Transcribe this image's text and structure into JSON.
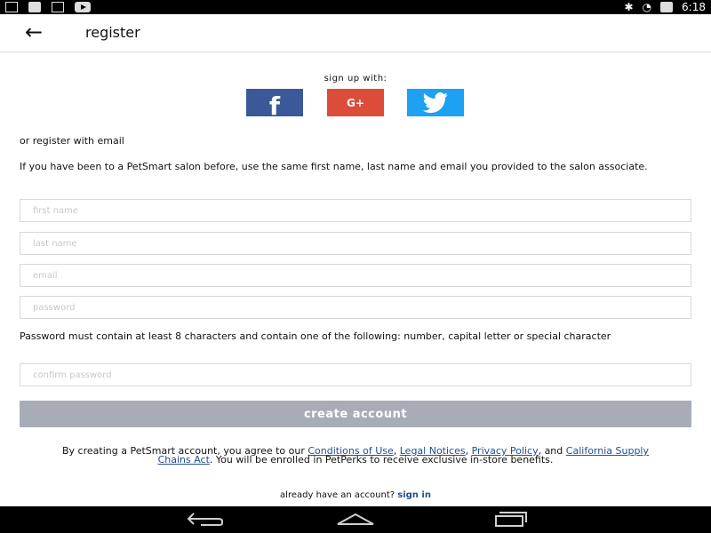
{
  "status_bar": {
    "time": "6:18",
    "left_icons": [
      "download-icon",
      "signal-bars-icon",
      "send-icon",
      "youtube-icon"
    ],
    "right_icons": [
      "bluetooth-icon",
      "wifi-icon",
      "battery-icon"
    ]
  },
  "toolbar": {
    "back_icon": "arrow-left-icon",
    "title": "register"
  },
  "social": {
    "heading": "sign up with:",
    "facebook_label": "f",
    "google_label": "G+",
    "twitter_icon": "twitter-bird-icon",
    "colors": {
      "facebook": "#3b5998",
      "google": "#dd4b39",
      "twitter": "#1da1f2"
    }
  },
  "form": {
    "or_text": "or register with email",
    "info_text": "If you have been to a PetSmart salon before, use the same first name, last name and email you provided to the salon associate.",
    "first_name_placeholder": "first name",
    "last_name_placeholder": "last name",
    "email_placeholder": "email",
    "password_placeholder": "password",
    "password_note": "Password must contain at least 8 characters and contain one of the following: number, capital letter or special character",
    "confirm_placeholder": "confirm password",
    "create_label": "create account"
  },
  "terms": {
    "prefix": "By creating a PetSmart account, you agree to our",
    "link1": "Conditions of Use",
    "sep1": ",",
    "link2": "Legal Notices",
    "sep2": ",",
    "link3": "Privacy Policy",
    "and": ", and",
    "link4": "California Supply Chains Act",
    "suffix": ". You will be enrolled in PetPerks to receive exclusive in-store benefits."
  },
  "footer": {
    "already_text": "already have an account?",
    "signin_label": "sign in"
  },
  "nav_bar": {
    "back_icon": "nav-back-icon",
    "home_icon": "nav-home-icon",
    "recents_icon": "nav-recents-icon"
  }
}
